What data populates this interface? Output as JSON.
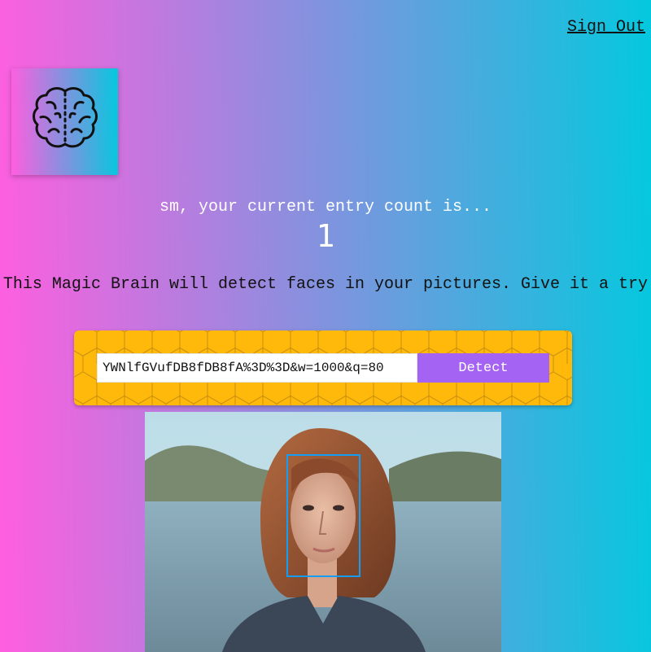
{
  "nav": {
    "sign_out_label": "Sign Out"
  },
  "logo": {
    "icon": "brain-icon"
  },
  "rank": {
    "message": "sm, your current entry count is...",
    "count": "1"
  },
  "intro": {
    "text": "This Magic Brain will detect faces in your pictures. Give it a try"
  },
  "form": {
    "url_value": "YWNlfGVufDB8fDB8fA%3D%3D&w=1000&q=80",
    "detect_label": "Detect"
  },
  "colors": {
    "gradient_start": "#ff5edf",
    "gradient_end": "#04c8de",
    "panel_bg": "#ffb90a",
    "button_bg": "#a463f2",
    "face_box": "#149df2"
  }
}
